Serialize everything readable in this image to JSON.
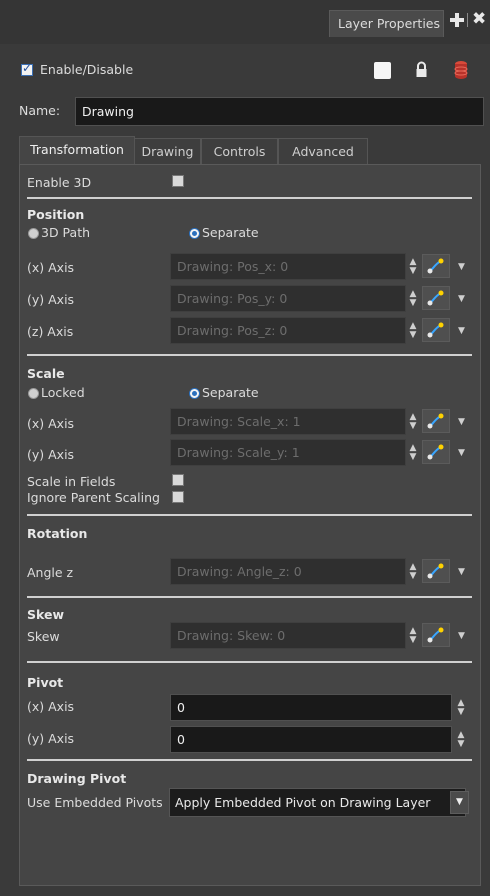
{
  "window": {
    "tab_title": "Layer Properties"
  },
  "header": {
    "enable_label": "Enable/Disable",
    "name_label": "Name:",
    "name_value": "Drawing"
  },
  "tabs": [
    {
      "label": "Transformation"
    },
    {
      "label": "Drawing"
    },
    {
      "label": "Controls"
    },
    {
      "label": "Advanced"
    }
  ],
  "transformation": {
    "enable3d_label": "Enable 3D",
    "position": {
      "title": "Position",
      "opt_3dpath": "3D Path",
      "opt_separate": "Separate",
      "x_label": "(x) Axis",
      "x_value": "Drawing: Pos_x: 0",
      "y_label": "(y) Axis",
      "y_value": "Drawing: Pos_y: 0",
      "z_label": "(z) Axis",
      "z_value": "Drawing: Pos_z: 0"
    },
    "scale": {
      "title": "Scale",
      "opt_locked": "Locked",
      "opt_separate": "Separate",
      "x_label": "(x) Axis",
      "x_value": "Drawing: Scale_x: 1",
      "y_label": "(y) Axis",
      "y_value": "Drawing: Scale_y: 1",
      "fields_label": "Scale in Fields",
      "ignore_label": "Ignore Parent Scaling"
    },
    "rotation": {
      "title": "Rotation",
      "angle_label": "Angle z",
      "angle_value": "Drawing: Angle_z: 0"
    },
    "skew": {
      "title": "Skew",
      "skew_label": "Skew",
      "skew_value": "Drawing: Skew: 0"
    },
    "pivot": {
      "title": "Pivot",
      "x_label": "(x) Axis",
      "x_value": "0",
      "y_label": "(y) Axis",
      "y_value": "0"
    },
    "drawing_pivot": {
      "title": "Drawing Pivot",
      "label": "Use Embedded Pivots",
      "value": "Apply Embedded Pivot on Drawing Layer"
    }
  },
  "icons": {
    "plus": "plus-icon",
    "close": "close-icon",
    "color_swatch": "color-swatch-icon",
    "lock": "lock-icon",
    "stack": "layer-stack-icon",
    "function": "function-curve-icon",
    "spin": "spin-arrows-icon",
    "dropdown": "chevron-down-icon"
  },
  "colors": {
    "background": "#3a3a3a",
    "panel": "#454545",
    "field": "#2f2f2f",
    "active_field": "#191919",
    "accent": "#2a6fbd",
    "stack_red": "#c0392b"
  }
}
